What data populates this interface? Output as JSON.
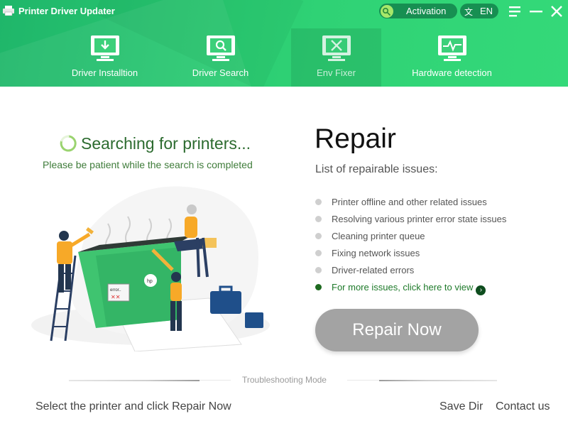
{
  "app": {
    "title": "Printer Driver Updater",
    "icon": "printer-icon"
  },
  "titlebar": {
    "activation_label": "Activation",
    "language_label": "EN",
    "menu_icon": "menu-icon",
    "minimize_icon": "minimize-icon",
    "close_icon": "close-icon"
  },
  "tabs": [
    {
      "label": "Driver Installtion",
      "icon": "download-monitor-icon",
      "active": false
    },
    {
      "label": "Driver Search",
      "icon": "search-monitor-icon",
      "active": false
    },
    {
      "label": "Env Fixer",
      "icon": "tools-monitor-icon",
      "active": true
    },
    {
      "label": "Hardware detection",
      "icon": "pulse-monitor-icon",
      "active": false
    }
  ],
  "search": {
    "title": "Searching for printers...",
    "subtitle": "Please be patient while the search is completed"
  },
  "illustration": {
    "error_text": "error..",
    "brand_text": "hp"
  },
  "repair": {
    "title": "Repair",
    "subtitle": "List of repairable issues:",
    "issues": [
      "Printer offline and other related issues",
      "Resolving various printer error state issues",
      "Cleaning printer queue",
      "Fixing network issues",
      "Driver-related errors"
    ],
    "more_link": "For more issues, click here to view",
    "button_label": "Repair Now"
  },
  "footer": {
    "mode_label": "Troubleshooting Mode",
    "status": "Select the printer and click Repair Now",
    "save_dir": "Save Dir",
    "contact": "Contact us"
  },
  "colors": {
    "header_green": "#2fd275",
    "accent_dark_green": "#1e7a2a",
    "button_gray": "#a3a3a3"
  }
}
